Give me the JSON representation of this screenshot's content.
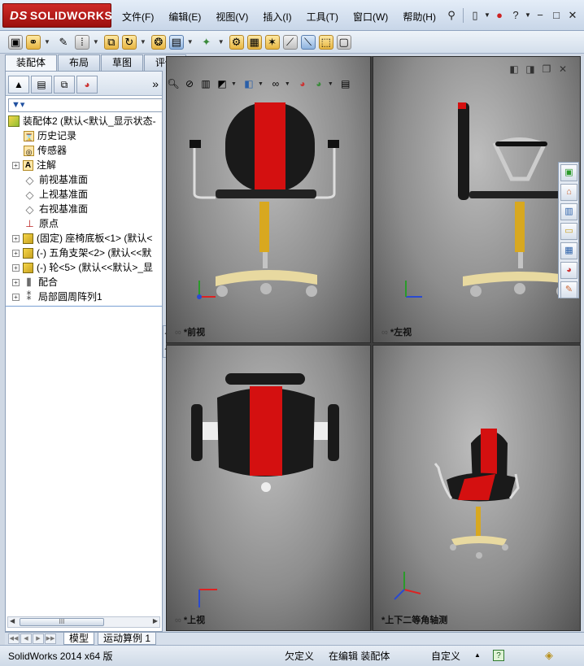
{
  "app": {
    "logo_text": "SOLIDWORKS",
    "logo_mark": "DS"
  },
  "menu": [
    {
      "label": "文件(F)"
    },
    {
      "label": "编辑(E)"
    },
    {
      "label": "视图(V)"
    },
    {
      "label": "插入(I)"
    },
    {
      "label": "工具(T)"
    },
    {
      "label": "窗口(W)"
    },
    {
      "label": "帮助(H)"
    }
  ],
  "command_tabs": [
    {
      "label": "装配体"
    },
    {
      "label": "布局"
    },
    {
      "label": "草图"
    },
    {
      "label": "评估"
    }
  ],
  "feature_tree": {
    "more": "»",
    "root": "装配体2  (默认<默认_显示状态-",
    "items": [
      {
        "label": "历史记录",
        "icon": "history-icon",
        "expandable": false
      },
      {
        "label": "传感器",
        "icon": "sensor-icon",
        "expandable": false
      },
      {
        "label": "注解",
        "icon": "annotation-icon",
        "expandable": true
      },
      {
        "label": "前视基准面",
        "icon": "plane-icon",
        "expandable": false
      },
      {
        "label": "上视基准面",
        "icon": "plane-icon",
        "expandable": false
      },
      {
        "label": "右视基准面",
        "icon": "plane-icon",
        "expandable": false
      },
      {
        "label": "原点",
        "icon": "origin-icon",
        "expandable": false
      },
      {
        "label": "(固定) 座椅底板<1> (默认<",
        "icon": "part-icon",
        "expandable": true
      },
      {
        "label": "(-) 五角支架<2> (默认<<默",
        "icon": "part-icon",
        "expandable": true
      },
      {
        "label": "(-) 轮<5> (默认<<默认>_显",
        "icon": "part-icon",
        "expandable": true
      },
      {
        "label": "配合",
        "icon": "mates-icon",
        "expandable": true
      },
      {
        "label": "局部圆周阵列1",
        "icon": "pattern-icon",
        "expandable": true
      }
    ],
    "scroll_label": "III"
  },
  "viewports": [
    {
      "label": "*前视"
    },
    {
      "label": "*左视"
    },
    {
      "label": "*上视"
    },
    {
      "label": "*上下二等角轴测"
    }
  ],
  "bottom_tabs": [
    {
      "label": "模型"
    },
    {
      "label": "运动算例 1"
    }
  ],
  "status": {
    "version": "SolidWorks 2014 x64 版",
    "definition": "欠定义",
    "editing": "在编辑 装配体",
    "custom": "自定义",
    "help": "?"
  },
  "colors": {
    "seat_red": "#d41010",
    "seat_black": "#1a1a1a",
    "gas_lift_yellow": "#d8a820",
    "base_cream": "#e8d9a0",
    "titlebar": "#c8d6e8"
  }
}
